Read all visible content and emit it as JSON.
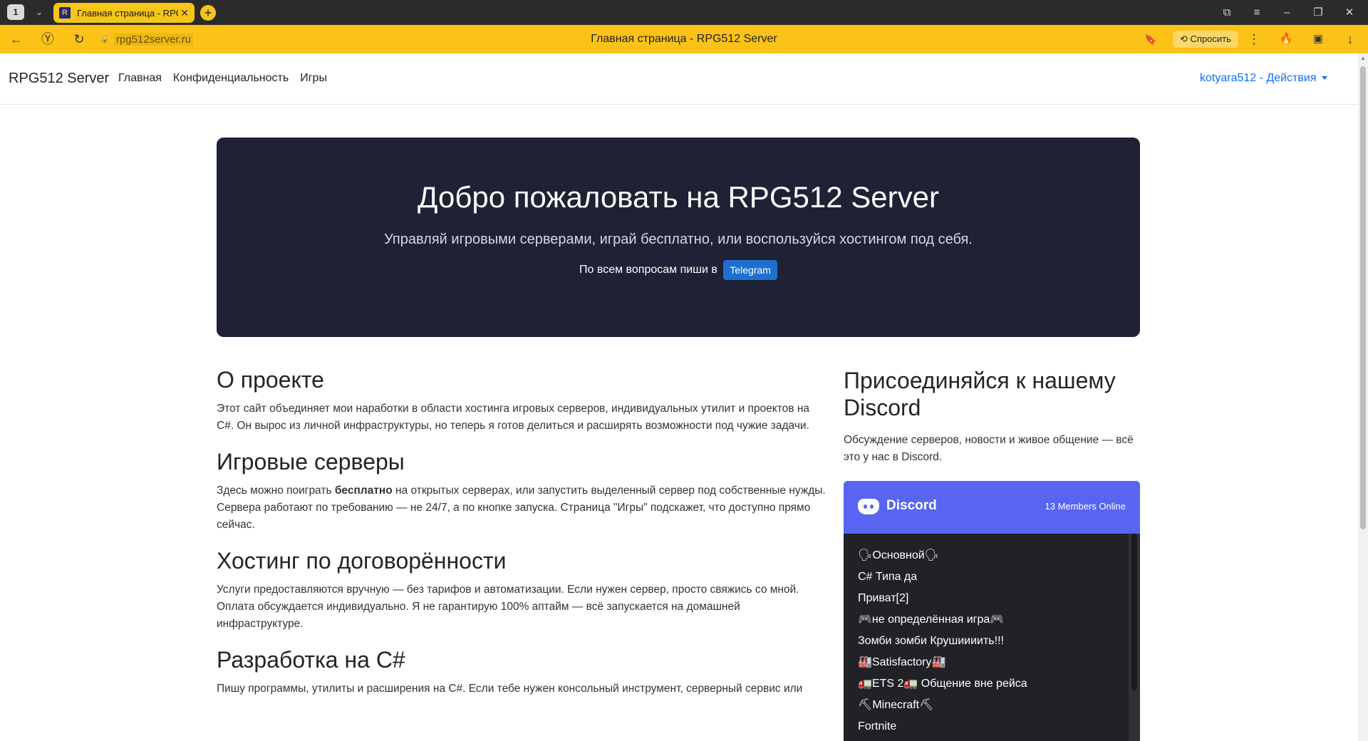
{
  "browser": {
    "tab_count": "1",
    "tab_favicon": "R",
    "tab_title": "Главная страница - RPG512 Server",
    "url": "rpg512server.ru",
    "page_title": "Главная страница - RPG512 Server",
    "ask_label": "Спросить",
    "accent": "#fbc217"
  },
  "navbar": {
    "brand": "RPG512 Server",
    "links": [
      "Главная",
      "Конфиденциальность",
      "Игры"
    ],
    "user_menu": "kotyara512 - Действия"
  },
  "hero": {
    "title": "Добро пожаловать на RPG512 Server",
    "subtitle": "Управляй игровыми серверами, играй бесплатно, или воспользуйся хостингом под себя.",
    "ask_text": "По всем вопросам пиши в",
    "telegram_label": "Telegram"
  },
  "sections": [
    {
      "title": "О проекте",
      "text": "Этот сайт объединяет мои наработки в области хостинга игровых серверов, индивидуальных утилит и проектов на C#. Он вырос из личной инфраструктуры, но теперь я готов делиться и расширять возможности под чужие задачи."
    },
    {
      "title": "Игровые серверы",
      "text_before": "Здесь можно поиграть ",
      "text_bold": "бесплатно",
      "text_after": " на открытых серверах, или запустить выделенный сервер под собственные нужды. Сервера работают по требованию — не 24/7, а по кнопке запуска. Страница \"Игры\" подскажет, что доступно прямо сейчас."
    },
    {
      "title": "Хостинг по договорённости",
      "text": "Услуги предоставляются вручную — без тарифов и автоматизации. Если нужен сервер, просто свяжись со мной. Оплата обсуждается индивидуально. Я не гарантирую 100% аптайм — всё запускается на домашней инфраструктуре."
    },
    {
      "title": "Разработка на C#",
      "text": "Пишу программы, утилиты и расширения на C#. Если тебе нужен консольный инструмент, серверный сервис или"
    }
  ],
  "discord": {
    "heading": "Присоединяйся к нашему Discord",
    "description": "Обсуждение серверов, новости и живое общение — всё это у нас в Discord.",
    "widget_name": "Discord",
    "online": "13 Members Online",
    "channels": [
      "🗣Основной🗣",
      "C# Типа да",
      "Приват[2]",
      "🎮не определённая игра🎮",
      "Зомби зомби Крушиииить!!!",
      "🏭Satisfactory🏭",
      "🚛ETS 2🚛 Общение вне рейса",
      "⛏Minecraft⛏",
      "Fortnite"
    ],
    "accent": "#5865f2"
  }
}
